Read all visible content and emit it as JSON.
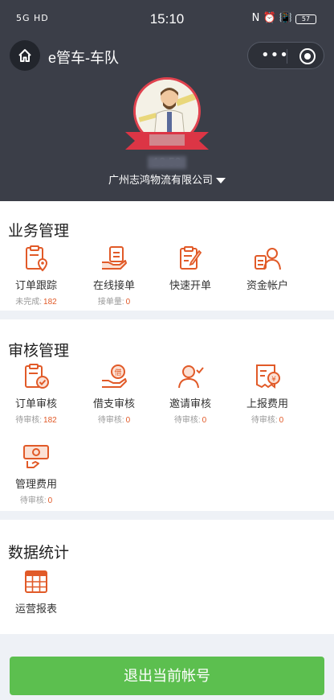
{
  "status_bar": {
    "signal": "5G",
    "hd": "HD",
    "time": "15:10",
    "icons": "N ⏰ 📳",
    "battery": "57"
  },
  "nav": {
    "title": "e管车-车队",
    "more": "•••"
  },
  "profile": {
    "phone": "18         53",
    "company": "广州志鸿物流有限公司"
  },
  "business": {
    "title": "业务管理",
    "items": [
      {
        "label": "订单跟踪",
        "sub_label": "未完成:",
        "sub_value": "182",
        "icon": "order-location-icon"
      },
      {
        "label": "在线接单",
        "sub_label": "接单量:",
        "sub_value": "0",
        "icon": "hand-clipboard-icon"
      },
      {
        "label": "快速开单",
        "sub_label": "",
        "sub_value": "",
        "icon": "clipboard-pen-icon"
      },
      {
        "label": "资金帐户",
        "sub_label": "",
        "sub_value": "",
        "icon": "account-user-icon"
      }
    ]
  },
  "audit": {
    "title": "审核管理",
    "items": [
      {
        "label": "订单审核",
        "sub_label": "待审核:",
        "sub_value": "182",
        "icon": "order-check-icon"
      },
      {
        "label": "借支审核",
        "sub_label": "待审核:",
        "sub_value": "0",
        "icon": "loan-hand-icon"
      },
      {
        "label": "邀请审核",
        "sub_label": "待审核:",
        "sub_value": "0",
        "icon": "user-check-icon"
      },
      {
        "label": "上报费用",
        "sub_label": "待审核:",
        "sub_value": "0",
        "icon": "receipt-yen-icon"
      },
      {
        "label": "管理费用",
        "sub_label": "待审核:",
        "sub_value": "0",
        "icon": "cash-hand-icon"
      }
    ]
  },
  "stats": {
    "title": "数据统计",
    "items": [
      {
        "label": "运营报表",
        "icon": "calendar-grid-icon"
      }
    ]
  },
  "logout_label": "退出当前帐号",
  "colors": {
    "header_bg": "#3b3e48",
    "accent": "#e15a28",
    "logout_bg": "#5cbf4f"
  }
}
